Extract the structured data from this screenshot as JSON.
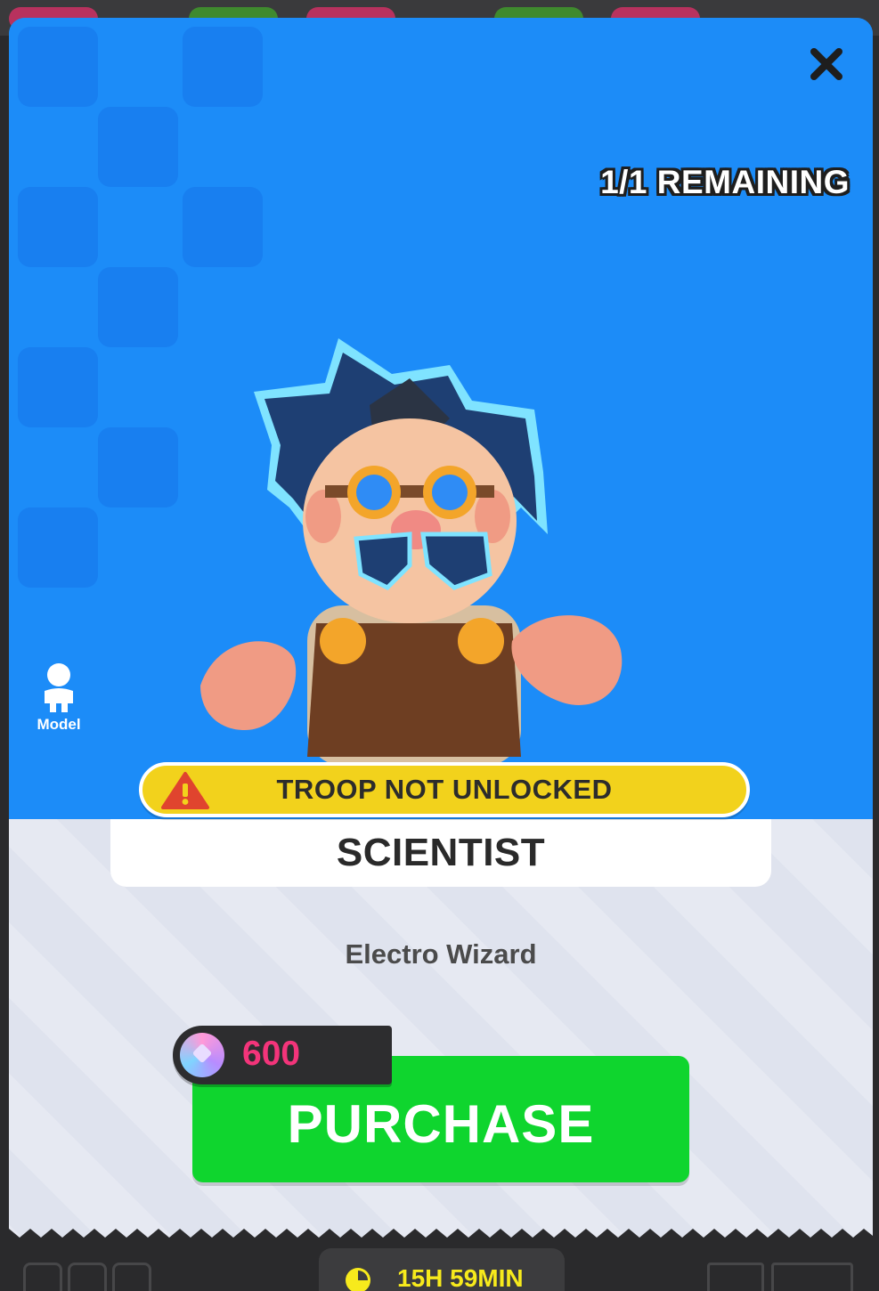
{
  "header": {
    "close_icon": "close-icon",
    "remaining_text": "1/1 REMAINING"
  },
  "preview": {
    "model_label": "Model",
    "model_icon": "person-icon"
  },
  "warning": {
    "text": "TROOP NOT UNLOCKED",
    "icon": "warning-icon",
    "color": "#f2d21c"
  },
  "troop": {
    "name": "SCIENTIST",
    "description": "Electro Wizard"
  },
  "price": {
    "amount": "600",
    "currency_icon": "gem-icon"
  },
  "purchase": {
    "label": "PURCHASE",
    "color": "#0fd52e"
  },
  "timer": {
    "text": "15H 59MIN",
    "icon": "clock-icon"
  },
  "colors": {
    "hero_bg": "#1c8cf8",
    "lower_bg": "#dfe3ee",
    "price_text": "#f3347a",
    "timer_text": "#f7ea1c"
  }
}
